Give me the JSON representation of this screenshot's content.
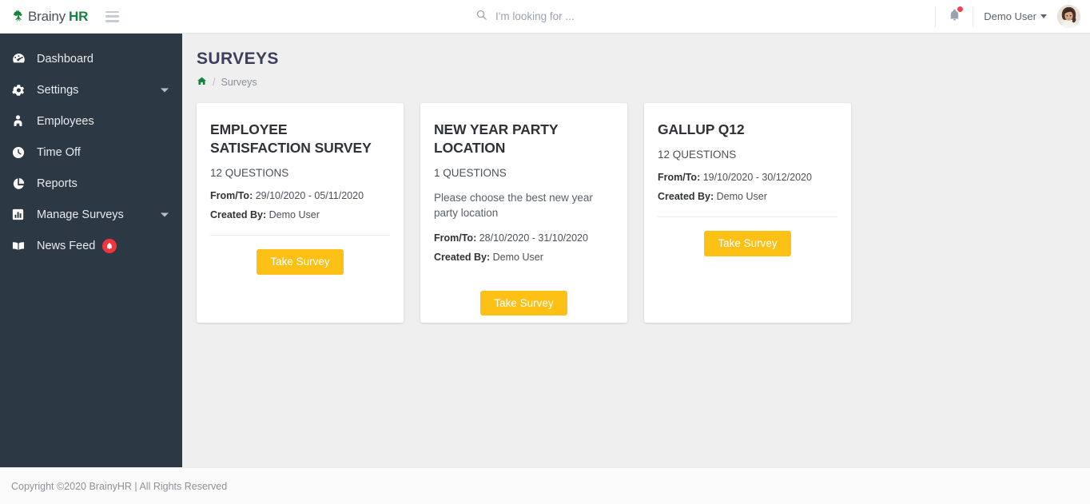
{
  "topbar": {
    "brand_primary": "Brainy",
    "brand_accent": "HR",
    "menu_icon": "hamburger-icon",
    "search": {
      "icon": "search-icon",
      "placeholder": "I'm looking for ...",
      "value": ""
    },
    "notification_icon": "bell-icon",
    "notification_dot": true,
    "user_name": "Demo User",
    "avatar": "user-avatar"
  },
  "sidebar": {
    "items": [
      {
        "label": "Dashboard",
        "icon": "speedometer-icon",
        "caret": false,
        "badge": null
      },
      {
        "label": "Settings",
        "icon": "gear-icon",
        "caret": true,
        "badge": null
      },
      {
        "label": "Employees",
        "icon": "user-tie-icon",
        "caret": false,
        "badge": null
      },
      {
        "label": "Time Off",
        "icon": "clock-icon",
        "caret": false,
        "badge": null
      },
      {
        "label": "Reports",
        "icon": "pie-chart-icon",
        "caret": false,
        "badge": null
      },
      {
        "label": "Manage Surveys",
        "icon": "bar-chart-icon",
        "caret": true,
        "badge": null
      },
      {
        "label": "News Feed",
        "icon": "book-icon",
        "caret": false,
        "badge": "bell-icon"
      }
    ]
  },
  "page": {
    "title": "SURVEYS",
    "breadcrumb": {
      "home_icon": "home-icon",
      "separator": "/",
      "current": "Surveys"
    }
  },
  "cards": [
    {
      "title": "EMPLOYEE SATISFACTION SURVEY",
      "questions": "12 QUESTIONS",
      "description": "",
      "fromto_label": "From/To:",
      "fromto_value": "29/10/2020 - 05/11/2020",
      "createdby_label": "Created By:",
      "createdby_value": "Demo User",
      "button": "Take Survey"
    },
    {
      "title": "NEW YEAR PARTY LOCATION",
      "questions": "1 QUESTIONS",
      "description": "Please choose the best new year party location",
      "fromto_label": "From/To:",
      "fromto_value": "28/10/2020 - 31/10/2020",
      "createdby_label": "Created By:",
      "createdby_value": "Demo User",
      "button": "Take Survey"
    },
    {
      "title": "GALLUP Q12",
      "questions": "12 QUESTIONS",
      "description": "",
      "fromto_label": "From/To:",
      "fromto_value": "19/10/2020 - 30/12/2020",
      "createdby_label": "Created By:",
      "createdby_value": "Demo User",
      "button": "Take Survey"
    }
  ],
  "footer": {
    "text": "Copyright ©2020 BrainyHR | All Rights Reserved"
  },
  "colors": {
    "accent_green": "#15843f",
    "sidebar_bg": "#2c3843",
    "button_amber": "#fdc015",
    "badge_red": "#f0353f",
    "content_bg": "#efeff0",
    "title_navy": "#3b3f5c"
  }
}
